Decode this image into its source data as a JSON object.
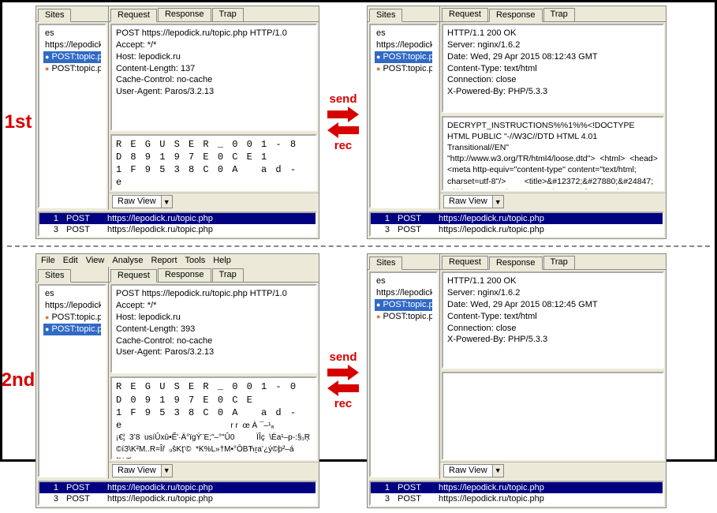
{
  "colors": {
    "red": "#d70000",
    "select_blue": "#316ac5",
    "nav_blue": "#000080"
  },
  "labels": {
    "first": "1st",
    "second": "2nd",
    "send": "send",
    "rec": "rec"
  },
  "menubar": [
    "File",
    "Edit",
    "View",
    "Analyse",
    "Report",
    "Tools",
    "Help"
  ],
  "tabs": {
    "sites": "Sites",
    "request": "Request",
    "response": "Response",
    "trap": "Trap"
  },
  "controls": {
    "rawview": "Raw View"
  },
  "sidebar": {
    "heading": "es",
    "items": [
      {
        "label": "https://lepodick.ru",
        "selected": false
      },
      {
        "label": "POST:topic.php",
        "selected": true
      },
      {
        "label": "POST:topic.php",
        "selected": false
      }
    ],
    "items_variant": [
      {
        "label": "https://lepodick.ru",
        "selected": false
      },
      {
        "label": "POST:topic.php",
        "selected": false
      },
      {
        "label": "POST:topic.php",
        "selected": true
      }
    ]
  },
  "request1": {
    "header": "POST https://lepodick.ru/topic.php HTTP/1.0\nAccept: */*\nHost: lepodick.ru\nContent-Length: 137\nCache-Control: no-cache\nUser-Agent: Paros/3.2.13",
    "body": "R E G U S E R _ 0 0 1 - 8 D 8 9 1 9 7 E 0 C E 1\n1 F 9 5 3 8 C 0 A   a d - e"
  },
  "response1": {
    "header": "HTTP/1.1 200 OK\nServer: nginx/1.6.2\nDate: Wed, 29 Apr 2015 08:12:43 GMT\nContent-Type: text/html\nConnection: close\nX-Powered-By: PHP/5.3.3",
    "body": "DECRYPT_INSTRUCTIONS%%1%%<!DOCTYPE HTML PUBLIC \"-//W3C//DTD HTML 4.01 Transitional//EN\" \"http://www.w3.org/TR/html4/loose.dtd\">  <html>  <head>          <meta http-equiv=\"content-type\" content=\"text/html; charset=utf-8\"/>        <title>&#12372;&#27880;&#24847;</title>        <style type=\"text/css\">  * {     margin:"
  },
  "request2": {
    "header": "POST https://lepodick.ru/topic.php HTTP/1.0\nAccept: */*\nHost: lepodick.ru\nContent-Length: 393\nCache-Control: no-cache\nUser-Agent: Paros/3.2.13",
    "body_mono": "R E G U S E R _ 0 0 1 - 0 D 0 9 1 9 7 E 0 C E\n1 F 9 5 3 8 C 0 A   a d - e",
    "body_extra": "                                                 r r  œ À ¯–¹ₐ\n¡€¦  3‛8  usíÛxû•Ẽ'·Ä°ïgÝ¨E;\"–°\"Û0          ÏÎç  \\Ëa¹–p-:§₁Ŗ\n©íЗ\\K²M..R=Îř  ᵤŝKţ‛©  *K%L»†M•°ŌBЋṟa‛¿ý©þ²–á  f%Ø"
  },
  "response2": {
    "header": "HTTP/1.1 200 OK\nServer: nginx/1.6.2\nDate: Wed, 29 Apr 2015 08:12:45 GMT\nContent-Type: text/html\nConnection: close\nX-Powered-By: PHP/5.3.3",
    "body": ""
  },
  "bottom_rows": [
    {
      "n": "1",
      "m": "POST",
      "u": "https://lepodick.ru/topic.php",
      "sel": true
    },
    {
      "n": "3",
      "m": "POST",
      "u": "https://lepodick.ru/topic.php",
      "sel": false
    }
  ]
}
